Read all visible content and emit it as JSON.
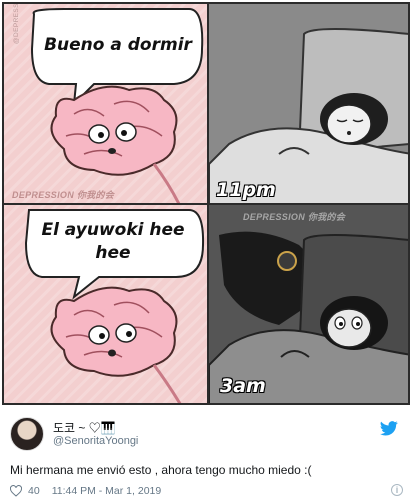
{
  "meme": {
    "top_bubble": "Bueno a dormir",
    "bottom_bubble_line1": "El ayuwoki hee",
    "bottom_bubble_line2": "hee",
    "time_top": "11pm",
    "time_bottom": "3am",
    "watermark": "DEPRESSION 你我的会",
    "credit": "@DEPRESSION你我的会 / INSTAGRAM"
  },
  "tweet": {
    "display_name": "도코 ~ ♡🎹",
    "handle": "@SenoritaYoongi",
    "text": "Mi hermana me envió esto , ahora tengo mucho miedo :(",
    "likes": "40",
    "timestamp": "11:44 PM - Mar 1, 2019",
    "info_glyph": "i",
    "accent_color": "#1da1f2"
  }
}
